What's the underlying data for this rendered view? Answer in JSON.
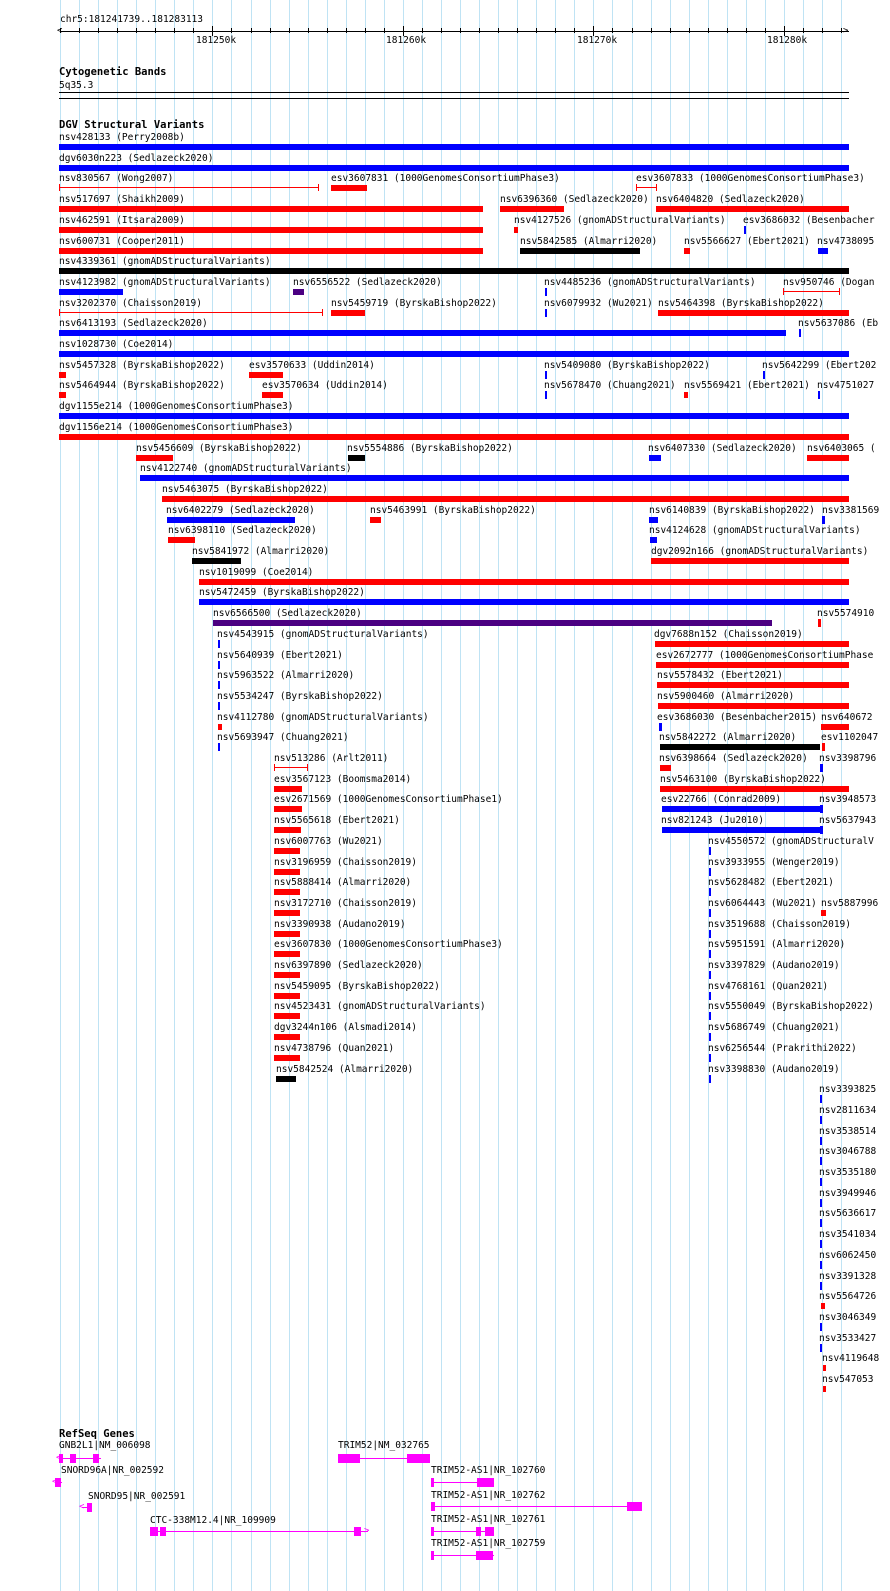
{
  "ruler": {
    "location": "chr5:181241739..181283113",
    "ticks": [
      "181250k",
      "181260k",
      "181270k",
      "181280k"
    ]
  },
  "cytoband": {
    "title": "Cytogenetic Bands",
    "band": "5q35.3"
  },
  "dgv": {
    "title": "DGV Structural Variants",
    "colors": {
      "loss": "#ff0000",
      "gain": "#0000ff",
      "complex": "#000000",
      "inversion": "#4b0082"
    },
    "features": [
      {
        "label": "nsv428133 (Perry2008b)",
        "color": "#0000ff"
      },
      {
        "label": "dgv6030n223 (Sedlazeck2020)",
        "color": "#0000ff"
      },
      {
        "label": "nsv830567 (Wong2007)",
        "color": "#ff0000"
      },
      {
        "label": "esv3607831 (1000GenomesConsortiumPhase3)",
        "color": "#ff0000"
      },
      {
        "label": "esv3607833 (1000GenomesConsortiumPhase3)",
        "color": "#ff0000"
      },
      {
        "label": "nsv517697 (Shaikh2009)",
        "color": "#ff0000"
      },
      {
        "label": "nsv6396360 (Sedlazeck2020)",
        "color": "#ff0000"
      },
      {
        "label": "nsv6404820 (Sedlazeck2020)",
        "color": "#ff0000"
      },
      {
        "label": "nsv462591 (Itsara2009)",
        "color": "#ff0000"
      },
      {
        "label": "nsv4127526 (gnomADStructuralVariants)",
        "color": "#ff0000"
      },
      {
        "label": "esv3686032 (Besenbacher",
        "color": "#0000ff"
      },
      {
        "label": "nsv600731 (Cooper2011)",
        "color": "#ff0000"
      },
      {
        "label": "nsv5842585 (Almarri2020)",
        "color": "#000000"
      },
      {
        "label": "nsv5566627 (Ebert2021)",
        "color": "#ff0000"
      },
      {
        "label": "nsv4738095",
        "color": "#0000ff"
      },
      {
        "label": "nsv4339361 (gnomADStructuralVariants)",
        "color": "#000000"
      },
      {
        "label": "nsv4123982 (gnomADStructuralVariants)",
        "color": "#0000ff"
      },
      {
        "label": "nsv6556522 (Sedlazeck2020)",
        "color": "#4b0082"
      },
      {
        "label": "nsv4485236 (gnomADStructuralVariants)",
        "color": "#0000ff"
      },
      {
        "label": "nsv950746 (Dogan",
        "color": "#ff0000"
      },
      {
        "label": "nsv3202370 (Chaisson2019)",
        "color": "#ff0000"
      },
      {
        "label": "nsv5459719 (ByrskaBishop2022)",
        "color": "#ff0000"
      },
      {
        "label": "nsv6079932 (Wu2021)",
        "color": "#0000ff"
      },
      {
        "label": "nsv5464398 (ByrskaBishop2022)",
        "color": "#ff0000"
      },
      {
        "label": "nsv6413193 (Sedlazeck2020)",
        "color": "#0000ff"
      },
      {
        "label": "nsv5637086 (Eb",
        "color": "#0000ff"
      },
      {
        "label": "nsv1028730 (Coe2014)",
        "color": "#0000ff"
      },
      {
        "label": "nsv5457328 (ByrskaBishop2022)",
        "color": "#ff0000"
      },
      {
        "label": "esv3570633 (Uddin2014)",
        "color": "#ff0000"
      },
      {
        "label": "nsv5409080 (ByrskaBishop2022)",
        "color": "#0000ff"
      },
      {
        "label": "nsv5642299 (Ebert202",
        "color": "#0000ff"
      },
      {
        "label": "nsv5464944 (ByrskaBishop2022)",
        "color": "#ff0000"
      },
      {
        "label": "esv3570634 (Uddin2014)",
        "color": "#ff0000"
      },
      {
        "label": "nsv5678470 (Chuang2021)",
        "color": "#0000ff"
      },
      {
        "label": "nsv5569421 (Ebert2021)",
        "color": "#ff0000"
      },
      {
        "label": "nsv4751027",
        "color": "#0000ff"
      },
      {
        "label": "dgv1155e214 (1000GenomesConsortiumPhase3)",
        "color": "#0000ff"
      },
      {
        "label": "dgv1156e214 (1000GenomesConsortiumPhase3)",
        "color": "#ff0000"
      },
      {
        "label": "nsv5456609 (ByrskaBishop2022)",
        "color": "#ff0000"
      },
      {
        "label": "nsv5554886 (ByrskaBishop2022)",
        "color": "#000000"
      },
      {
        "label": "nsv6407330 (Sedlazeck2020)",
        "color": "#0000ff"
      },
      {
        "label": "nsv6403065 (",
        "color": "#ff0000"
      },
      {
        "label": "nsv4122740 (gnomADStructuralVariants)",
        "color": "#0000ff"
      },
      {
        "label": "nsv5463075 (ByrskaBishop2022)",
        "color": "#ff0000"
      },
      {
        "label": "nsv6402279 (Sedlazeck2020)",
        "color": "#0000ff"
      },
      {
        "label": "nsv5463991 (ByrskaBishop2022)",
        "color": "#ff0000"
      },
      {
        "label": "nsv6140839 (ByrskaBishop2022)",
        "color": "#0000ff"
      },
      {
        "label": "nsv3381569",
        "color": "#0000ff"
      },
      {
        "label": "nsv6398110 (Sedlazeck2020)",
        "color": "#ff0000"
      },
      {
        "label": "nsv4124628 (gnomADStructuralVariants)",
        "color": "#0000ff"
      },
      {
        "label": "nsv5841972 (Almarri2020)",
        "color": "#000000"
      },
      {
        "label": "dgv2092n166 (gnomADStructuralVariants)",
        "color": "#ff0000"
      },
      {
        "label": "nsv1019099 (Coe2014)",
        "color": "#ff0000"
      },
      {
        "label": "nsv5472459 (ByrskaBishop2022)",
        "color": "#0000ff"
      },
      {
        "label": "nsv6566500 (Sedlazeck2020)",
        "color": "#4b0082"
      },
      {
        "label": "nsv5574910",
        "color": "#ff0000"
      },
      {
        "label": "nsv4543915 (gnomADStructuralVariants)",
        "color": "#0000ff"
      },
      {
        "label": "dgv7688n152 (Chaisson2019)",
        "color": "#ff0000"
      },
      {
        "label": "nsv5640939 (Ebert2021)",
        "color": "#0000ff"
      },
      {
        "label": "esv2672777 (1000GenomesConsortiumPhase",
        "color": "#ff0000"
      },
      {
        "label": "nsv5963522 (Almarri2020)",
        "color": "#0000ff"
      },
      {
        "label": "nsv5578432 (Ebert2021)",
        "color": "#ff0000"
      },
      {
        "label": "nsv5534247 (ByrskaBishop2022)",
        "color": "#0000ff"
      },
      {
        "label": "nsv5900460 (Almarri2020)",
        "color": "#ff0000"
      },
      {
        "label": "nsv4112780 (gnomADStructuralVariants)",
        "color": "#ff0000"
      },
      {
        "label": "esv3686030 (Besenbacher2015)",
        "color": "#0000ff"
      },
      {
        "label": "nsv640672",
        "color": "#ff0000"
      },
      {
        "label": "nsv5693947 (Chuang2021)",
        "color": "#0000ff"
      },
      {
        "label": "nsv5842272 (Almarri2020)",
        "color": "#000000"
      },
      {
        "label": "esv1102047",
        "color": "#ff0000"
      },
      {
        "label": "nsv513286 (Arlt2011)",
        "color": "#ff0000"
      },
      {
        "label": "nsv6398664 (Sedlazeck2020)",
        "color": "#ff0000"
      },
      {
        "label": "nsv3398796",
        "color": "#0000ff"
      },
      {
        "label": "esv3567123 (Boomsma2014)",
        "color": "#ff0000"
      },
      {
        "label": "nsv5463100 (ByrskaBishop2022)",
        "color": "#ff0000"
      },
      {
        "label": "esv2671569 (1000GenomesConsortiumPhase1)",
        "color": "#ff0000"
      },
      {
        "label": "esv22766 (Conrad2009)",
        "color": "#0000ff"
      },
      {
        "label": "nsv3948573",
        "color": "#0000ff"
      },
      {
        "label": "nsv5565618 (Ebert2021)",
        "color": "#ff0000"
      },
      {
        "label": "nsv821243 (Ju2010)",
        "color": "#0000ff"
      },
      {
        "label": "nsv5637943",
        "color": "#0000ff"
      },
      {
        "label": "nsv6007763 (Wu2021)",
        "color": "#ff0000"
      },
      {
        "label": "nsv4550572 (gnomADStructuralV",
        "color": "#0000ff"
      },
      {
        "label": "nsv3196959 (Chaisson2019)",
        "color": "#ff0000"
      },
      {
        "label": "nsv3933955 (Wenger2019)",
        "color": "#0000ff"
      },
      {
        "label": "nsv5888414 (Almarri2020)",
        "color": "#ff0000"
      },
      {
        "label": "nsv5628482 (Ebert2021)",
        "color": "#0000ff"
      },
      {
        "label": "nsv3172710 (Chaisson2019)",
        "color": "#ff0000"
      },
      {
        "label": "nsv6064443 (Wu2021)",
        "color": "#0000ff"
      },
      {
        "label": "nsv5887996",
        "color": "#ff0000"
      },
      {
        "label": "nsv3390938 (Audano2019)",
        "color": "#ff0000"
      },
      {
        "label": "nsv3519688 (Chaisson2019)",
        "color": "#0000ff"
      },
      {
        "label": "esv3607830 (1000GenomesConsortiumPhase3)",
        "color": "#ff0000"
      },
      {
        "label": "nsv5951591 (Almarri2020)",
        "color": "#0000ff"
      },
      {
        "label": "nsv6397890 (Sedlazeck2020)",
        "color": "#ff0000"
      },
      {
        "label": "nsv3397829 (Audano2019)",
        "color": "#0000ff"
      },
      {
        "label": "nsv5459095 (ByrskaBishop2022)",
        "color": "#ff0000"
      },
      {
        "label": "nsv4768161 (Quan2021)",
        "color": "#0000ff"
      },
      {
        "label": "nsv4523431 (gnomADStructuralVariants)",
        "color": "#ff0000"
      },
      {
        "label": "nsv5550049 (ByrskaBishop2022)",
        "color": "#0000ff"
      },
      {
        "label": "dgv3244n106 (Alsmadi2014)",
        "color": "#ff0000"
      },
      {
        "label": "nsv5686749 (Chuang2021)",
        "color": "#0000ff"
      },
      {
        "label": "nsv4738796 (Quan2021)",
        "color": "#ff0000"
      },
      {
        "label": "nsv6256544 (Prakrithi2022)",
        "color": "#0000ff"
      },
      {
        "label": "nsv5842524 (Almarri2020)",
        "color": "#000000"
      },
      {
        "label": "nsv3398830 (Audano2019)",
        "color": "#0000ff"
      },
      {
        "label": "nsv3393825",
        "color": "#0000ff"
      },
      {
        "label": "nsv2811634",
        "color": "#0000ff"
      },
      {
        "label": "nsv3538514",
        "color": "#0000ff"
      },
      {
        "label": "nsv3046788",
        "color": "#0000ff"
      },
      {
        "label": "nsv3535180",
        "color": "#0000ff"
      },
      {
        "label": "nsv3949946",
        "color": "#0000ff"
      },
      {
        "label": "nsv5636617",
        "color": "#0000ff"
      },
      {
        "label": "nsv3541034",
        "color": "#0000ff"
      },
      {
        "label": "nsv6062450",
        "color": "#0000ff"
      },
      {
        "label": "nsv3391328",
        "color": "#0000ff"
      },
      {
        "label": "nsv5564726",
        "color": "#ff0000"
      },
      {
        "label": "nsv3046349",
        "color": "#0000ff"
      },
      {
        "label": "nsv3533427",
        "color": "#0000ff"
      },
      {
        "label": "nsv4119648",
        "color": "#ff0000"
      },
      {
        "label": "nsv547053",
        "color": "#ff0000"
      }
    ]
  },
  "refseq": {
    "title": "RefSeq Genes",
    "color": "#ff00ff",
    "genes": [
      {
        "label": "GNB2L1|NM_006098"
      },
      {
        "label": "SNORD96A|NR_002592"
      },
      {
        "label": "SNORD95|NR_002591"
      },
      {
        "label": "CTC-338M12.4|NR_109909"
      },
      {
        "label": "TRIM52|NM_032765"
      },
      {
        "label": "TRIM52-AS1|NR_102760"
      },
      {
        "label": "TRIM52-AS1|NR_102762"
      },
      {
        "label": "TRIM52-AS1|NR_102761"
      },
      {
        "label": "TRIM52-AS1|NR_102759"
      }
    ]
  }
}
